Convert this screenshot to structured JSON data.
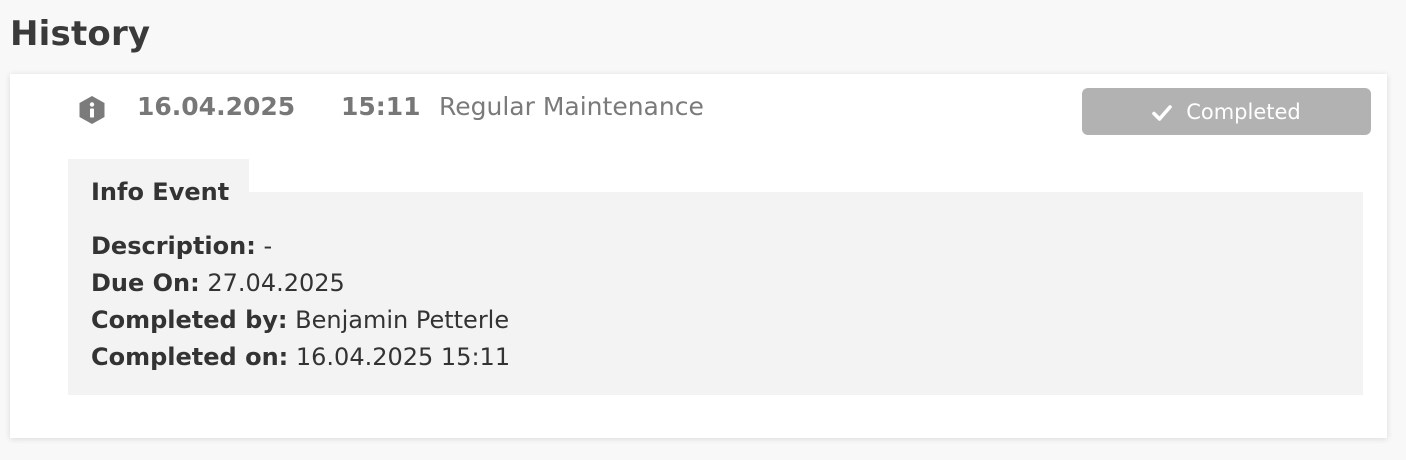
{
  "section": {
    "title": "History"
  },
  "event": {
    "icon": "info-icon",
    "date": "16.04.2025",
    "time": "15:11",
    "title": "Regular Maintenance",
    "status": {
      "label": "Completed",
      "icon": "check-icon",
      "color": "#b2b2b2"
    }
  },
  "details": {
    "heading": "Info Event",
    "rows": [
      {
        "label": "Description:",
        "value": "-"
      },
      {
        "label": "Due On:",
        "value": "27.04.2025"
      },
      {
        "label": "Completed by:",
        "value": "Benjamin Petterle"
      },
      {
        "label": "Completed on:",
        "value": "16.04.2025 15:11"
      }
    ]
  }
}
